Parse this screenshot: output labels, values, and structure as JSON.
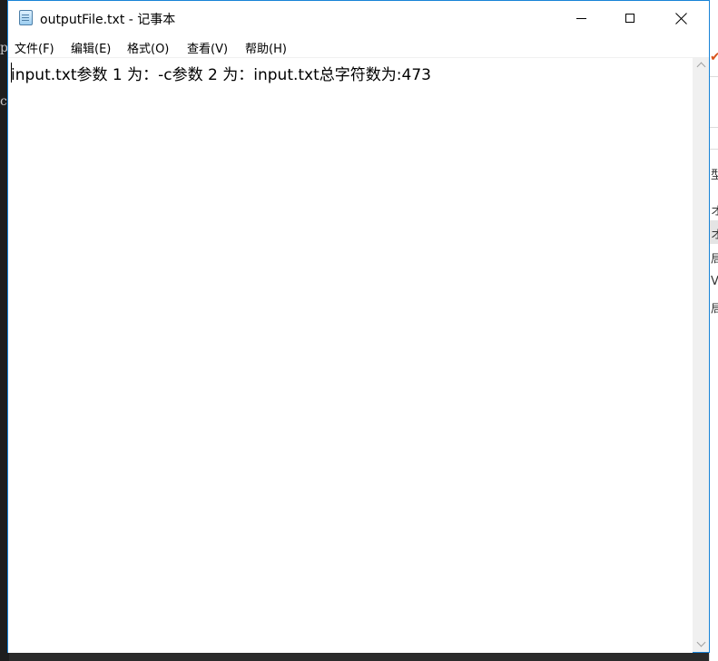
{
  "window": {
    "title": "outputFile.txt - 记事本",
    "icon": "notepad-icon"
  },
  "menu": {
    "items": [
      {
        "label": "文件(F)"
      },
      {
        "label": "编辑(E)"
      },
      {
        "label": "格式(O)"
      },
      {
        "label": "查看(V)"
      },
      {
        "label": "帮助(H)"
      }
    ]
  },
  "editor": {
    "content": "input.txt参数 1 为：-c参数 2 为：input.txt总字符数为:473"
  },
  "background": {
    "left_chars": [
      "p",
      "c"
    ],
    "right_chars": [
      "型",
      "オ",
      "オ",
      "局",
      "V",
      "局"
    ]
  },
  "colors": {
    "window_border": "#1883d7",
    "scrollbar_track": "#f0f0f0",
    "accent_mark": "#d9541e"
  }
}
